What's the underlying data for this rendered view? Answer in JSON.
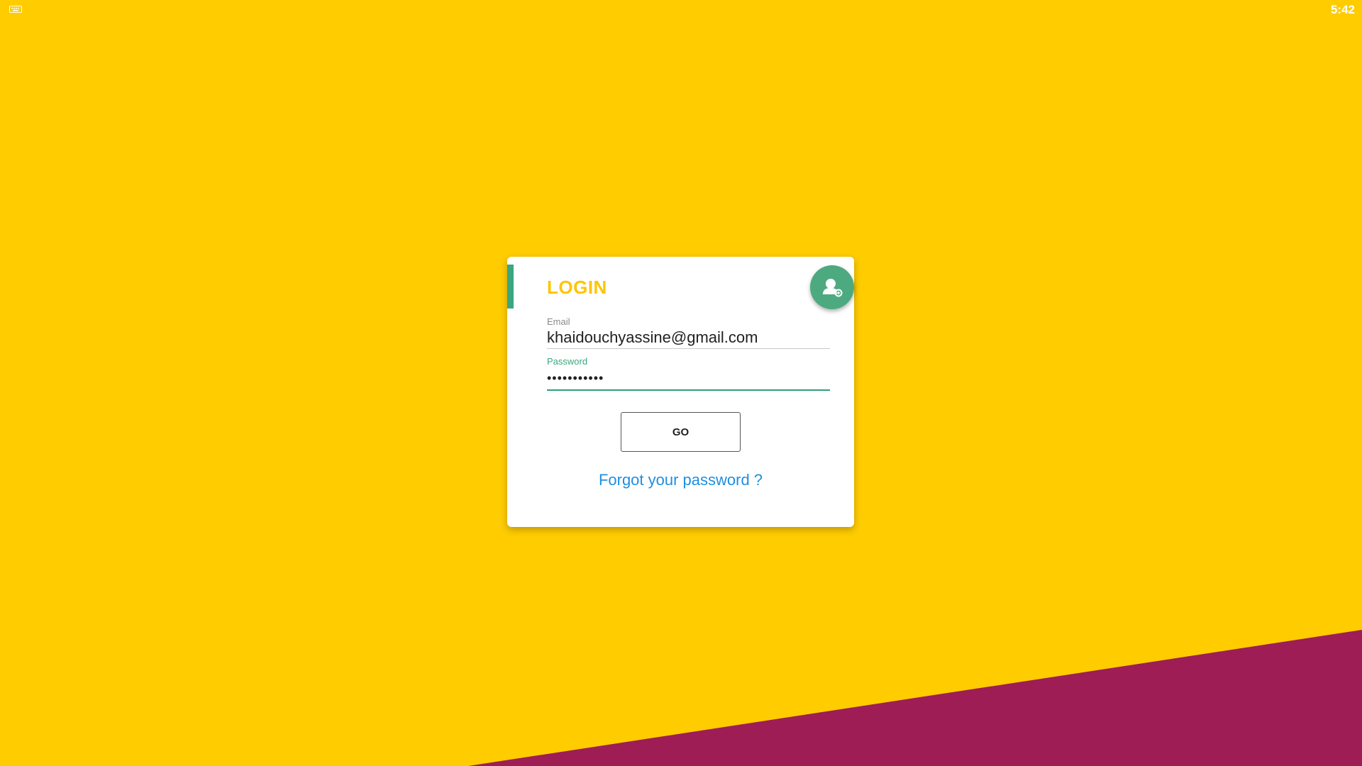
{
  "status_bar": {
    "time": "5:42",
    "left_icon": "keyboard-icon"
  },
  "colors": {
    "background": "#FFCC00",
    "background_shape": "#9E1D55",
    "accent": "#3BA77E",
    "title": "#FFC400",
    "link": "#1E8FE1"
  },
  "login": {
    "title": "LOGIN",
    "fab_icon": "add-account-icon",
    "email": {
      "label": "Email",
      "value": "khaidouchyassine@gmail.com"
    },
    "password": {
      "label": "Password",
      "value": "•••••••••••"
    },
    "go_label": "GO",
    "forgot_label": "Forgot your password ?"
  }
}
